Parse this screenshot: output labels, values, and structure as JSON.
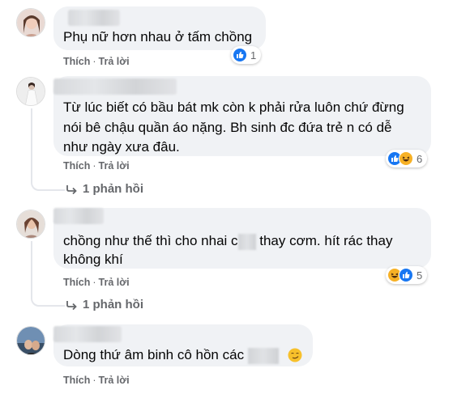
{
  "actions": {
    "like": "Thích",
    "reply": "Trả lời",
    "separator": "·"
  },
  "comments": [
    {
      "text_lines": [
        "Phụ nữ hơn nhau ở tấm chồng"
      ],
      "reactions": [
        "like"
      ],
      "reaction_count": "1"
    },
    {
      "text_lines": [
        "Từ lúc biết có bầu bát mk còn k phải rửa luôn chứ đừng",
        "nói bê chậu quần áo nặng. Bh sinh đc đứa trẻ n có dễ",
        "như ngày xưa đâu."
      ],
      "reactions": [
        "like",
        "haha"
      ],
      "reaction_count": "6",
      "replies_label": "1 phản hồi"
    },
    {
      "text_line1_before": "chồng như thế thì cho nhai c",
      "text_line1_after": " thay cơm. hít rác thay",
      "text_line2": "không khí",
      "reactions": [
        "haha",
        "like"
      ],
      "reaction_count": "5",
      "replies_label": "1 phản hồi"
    },
    {
      "text_before": "Dòng thứ âm binh cô hồn các",
      "emoji": "smirk-emoji"
    }
  ],
  "colors": {
    "bubble": "#f0f2f5",
    "meta_text": "#65676b",
    "like_blue": "#1877f2",
    "haha_yellow": "#f7b125"
  }
}
